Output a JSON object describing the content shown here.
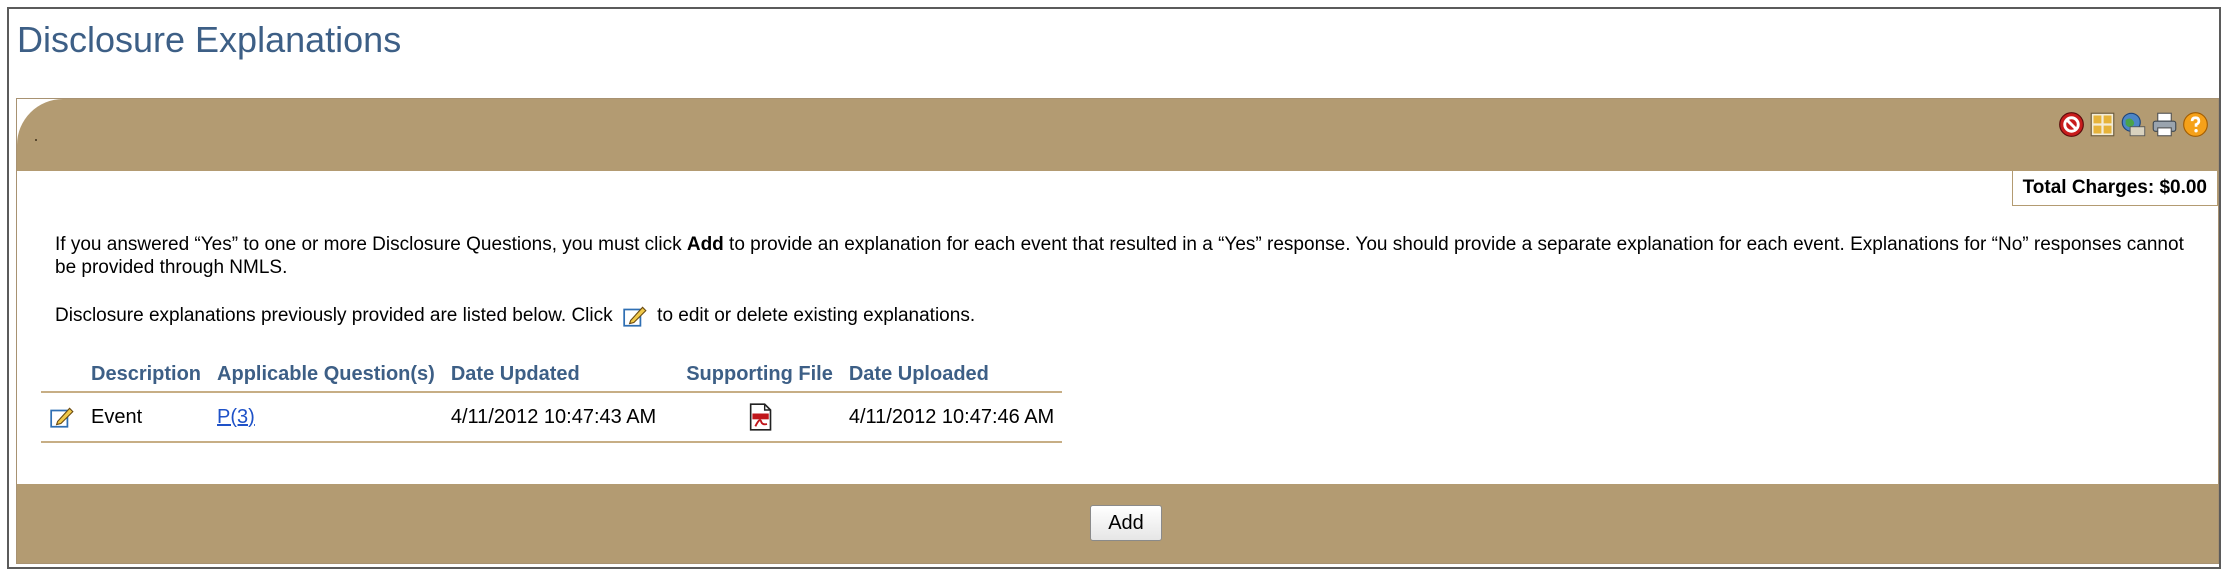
{
  "page": {
    "title": "Disclosure Explanations"
  },
  "toolbar": {
    "icons": [
      "stop-icon",
      "expand-icon",
      "globe-help-icon",
      "print-icon",
      "help-icon"
    ]
  },
  "charges": {
    "label": "Total Charges: $0.00"
  },
  "intro": {
    "part1": "If you answered “Yes” to one or more Disclosure Questions, you must click ",
    "bold": "Add",
    "part2": " to provide an explanation for each event that resulted in a “Yes” response. You should provide a separate explanation for each event. Explanations for “No” responses cannot be provided through NMLS."
  },
  "instruction": {
    "before": "Disclosure explanations previously provided are listed below. Click ",
    "after": " to edit or delete existing explanations."
  },
  "table": {
    "headers": {
      "description": "Description",
      "questions": "Applicable Question(s)",
      "date_updated": "Date Updated",
      "supporting_file": "Supporting File",
      "date_uploaded": "Date Uploaded"
    },
    "rows": [
      {
        "description": "Event",
        "questions": "P(3)",
        "date_updated": "4/11/2012 10:47:43 AM",
        "date_uploaded": "4/11/2012 10:47:46 AM"
      }
    ]
  },
  "footer": {
    "add_label": "Add"
  },
  "colors": {
    "band": "#b39b72",
    "title": "#3d5f86",
    "link": "#1f52c8"
  }
}
